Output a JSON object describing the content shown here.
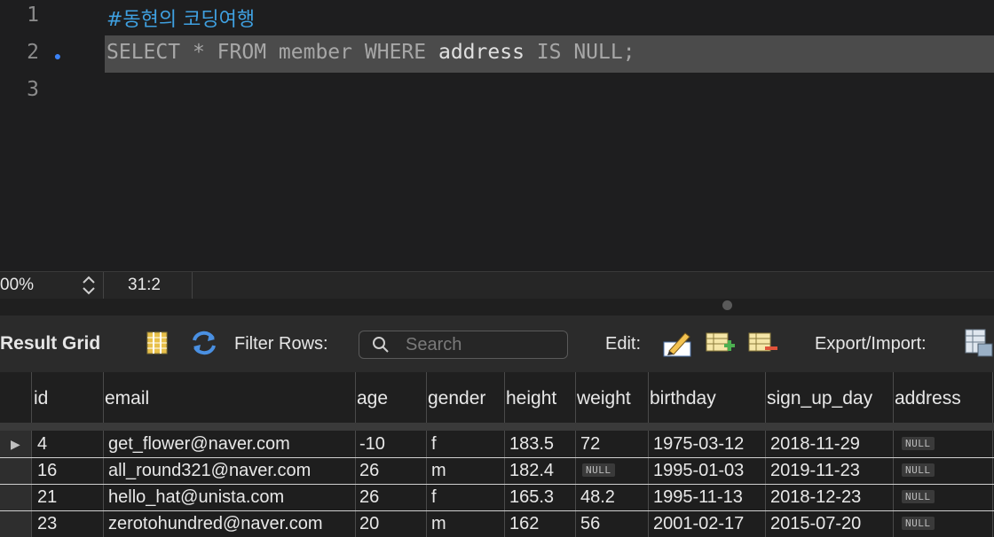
{
  "editor": {
    "lines": [
      {
        "number": "1",
        "text": "#동현의 코딩여행"
      },
      {
        "number": "2",
        "keyword1": "SELECT",
        "star": "*",
        "keyword2": "FROM",
        "table": "member",
        "keyword3": "WHERE",
        "column": "address",
        "keyword4": "IS NULL",
        "semi": ";"
      },
      {
        "number": "3"
      }
    ]
  },
  "status": {
    "zoom": "00%",
    "cursor": "31:2"
  },
  "toolbar": {
    "title": "Result Grid",
    "filter_label": "Filter Rows:",
    "search_placeholder": "Search",
    "edit_label": "Edit:",
    "export_label": "Export/Import:"
  },
  "grid": {
    "columns": [
      "id",
      "email",
      "age",
      "gender",
      "height",
      "weight",
      "birthday",
      "sign_up_day",
      "address"
    ],
    "null_text": "NULL",
    "rows": [
      [
        "4",
        "get_flower@naver.com",
        "-10",
        "f",
        "183.5",
        "72",
        "1975-03-12",
        "2018-11-29",
        "NULL"
      ],
      [
        "16",
        "all_round321@naver.com",
        "26",
        "m",
        "182.4",
        "NULL",
        "1995-01-03",
        "2019-11-23",
        "NULL"
      ],
      [
        "21",
        "hello_hat@unista.com",
        "26",
        "f",
        "165.3",
        "48.2",
        "1995-11-13",
        "2018-12-23",
        "NULL"
      ],
      [
        "23",
        "zerotohundred@naver.com",
        "20",
        "m",
        "162",
        "56",
        "2001-02-17",
        "2015-07-20",
        "NULL"
      ]
    ]
  },
  "colors": {
    "comment": "#3fa0e0",
    "highlight": "#4b4b4b",
    "marker": "#3b82f6"
  }
}
